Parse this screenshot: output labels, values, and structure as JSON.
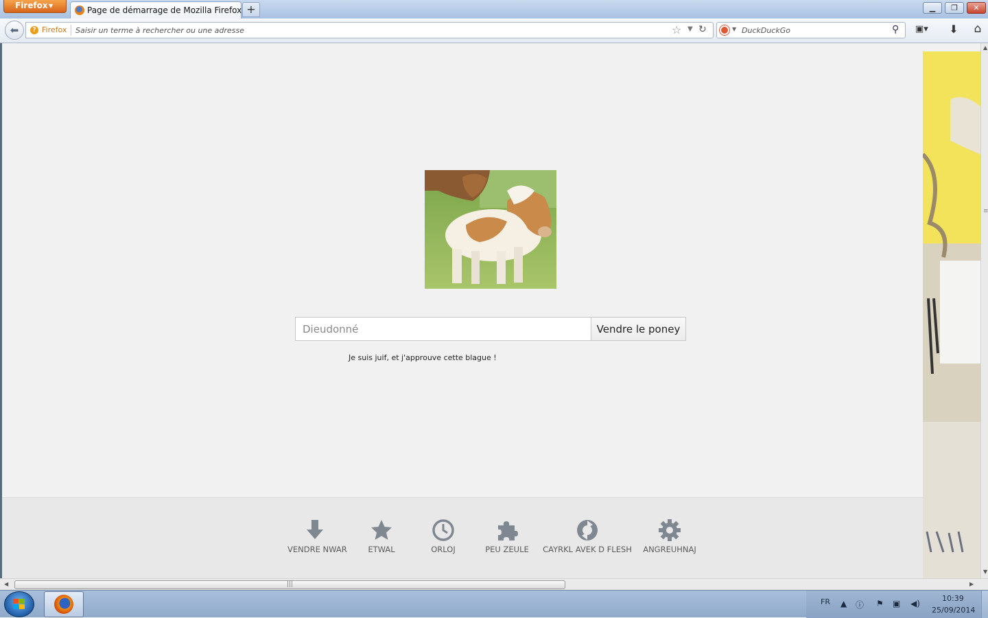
{
  "window": {
    "app_menu_label": "Firefox",
    "tab_title": "Page de démarrage de Mozilla Firefox",
    "new_tab_label": "+",
    "minimize_label": "▁",
    "maximize_label": "❐",
    "close_label": "✕"
  },
  "navbar": {
    "identity_label": "Firefox",
    "url_placeholder": "Saisir un terme à rechercher ou une adresse",
    "search_engine_placeholder": "DuckDuckGo"
  },
  "content": {
    "search_placeholder": "Dieudonné",
    "search_button_label": "Vendre le poney",
    "snippet_text": "Je suis juif, et j'approuve cette blague !",
    "launcher": [
      {
        "label": "VENDRE NWAR",
        "icon": "download-icon"
      },
      {
        "label": "ETWAL",
        "icon": "star-icon"
      },
      {
        "label": "ORLOJ",
        "icon": "clock-icon"
      },
      {
        "label": "PEU ZEULE",
        "icon": "puzzle-icon"
      },
      {
        "label": "CAYRKL AVEK D FLESH",
        "icon": "sync-icon"
      },
      {
        "label": "ANGREUHNAJ",
        "icon": "gear-icon"
      }
    ]
  },
  "taskbar": {
    "language": "FR",
    "time": "10:39",
    "date": "25/09/2014"
  },
  "colors": {
    "app_menu": "#e0742a",
    "content_bg": "#f1f1f1",
    "launcher_bg": "#e8e8e8",
    "launcher_icon": "#7f8791",
    "taskbar": "#9fb6d2"
  }
}
